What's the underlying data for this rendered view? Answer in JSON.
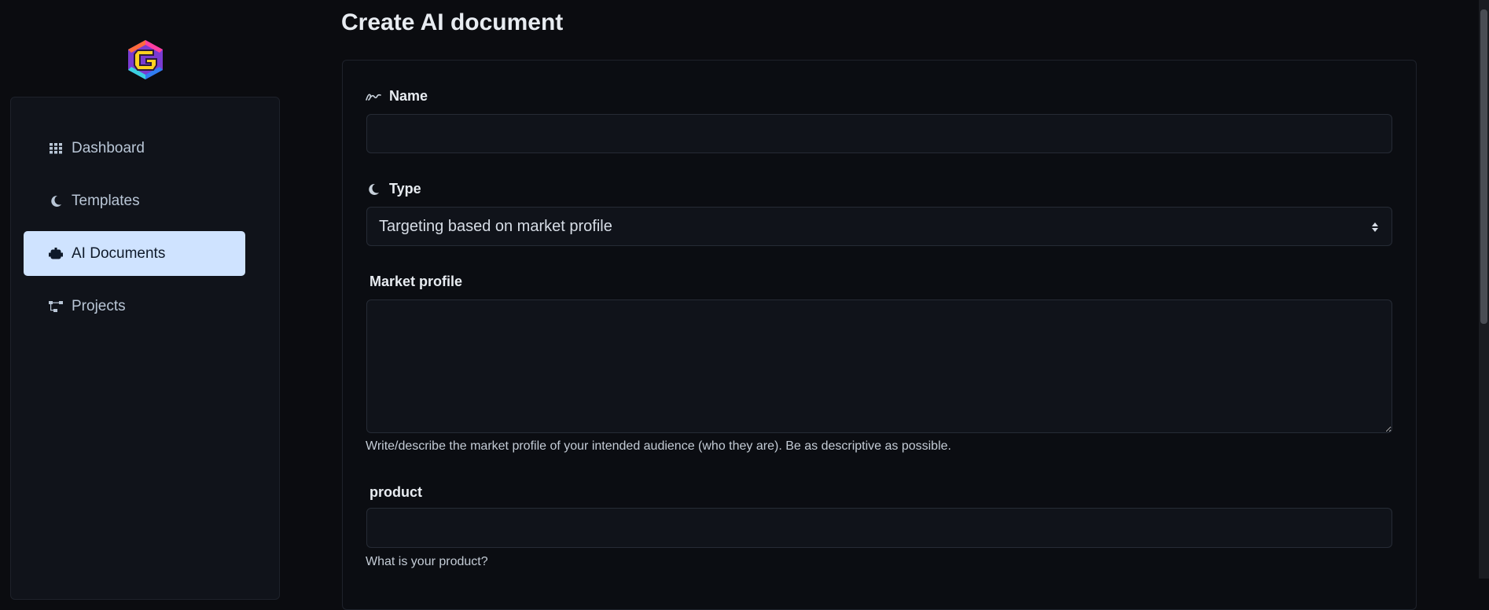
{
  "sidebar": {
    "items": [
      {
        "label": "Dashboard",
        "icon": "grid-icon",
        "active": false
      },
      {
        "label": "Templates",
        "icon": "moon-icon",
        "active": false
      },
      {
        "label": "AI Documents",
        "icon": "robot-icon",
        "active": true
      },
      {
        "label": "Projects",
        "icon": "sitemap-icon",
        "active": false
      }
    ]
  },
  "main": {
    "title": "Create AI document",
    "form": {
      "name_label": "Name",
      "name_value": "",
      "type_label": "Type",
      "type_value": "Targeting based on market profile",
      "market_profile_label": "Market profile",
      "market_profile_value": "",
      "market_profile_help": "Write/describe the market profile of your intended audience (who they are). Be as descriptive as possible.",
      "product_label": "product",
      "product_value": "",
      "product_help": "What is your product?"
    }
  },
  "colors": {
    "background": "#0b0c10",
    "panel": "#10131a",
    "active_nav": "#cfe3ff"
  }
}
